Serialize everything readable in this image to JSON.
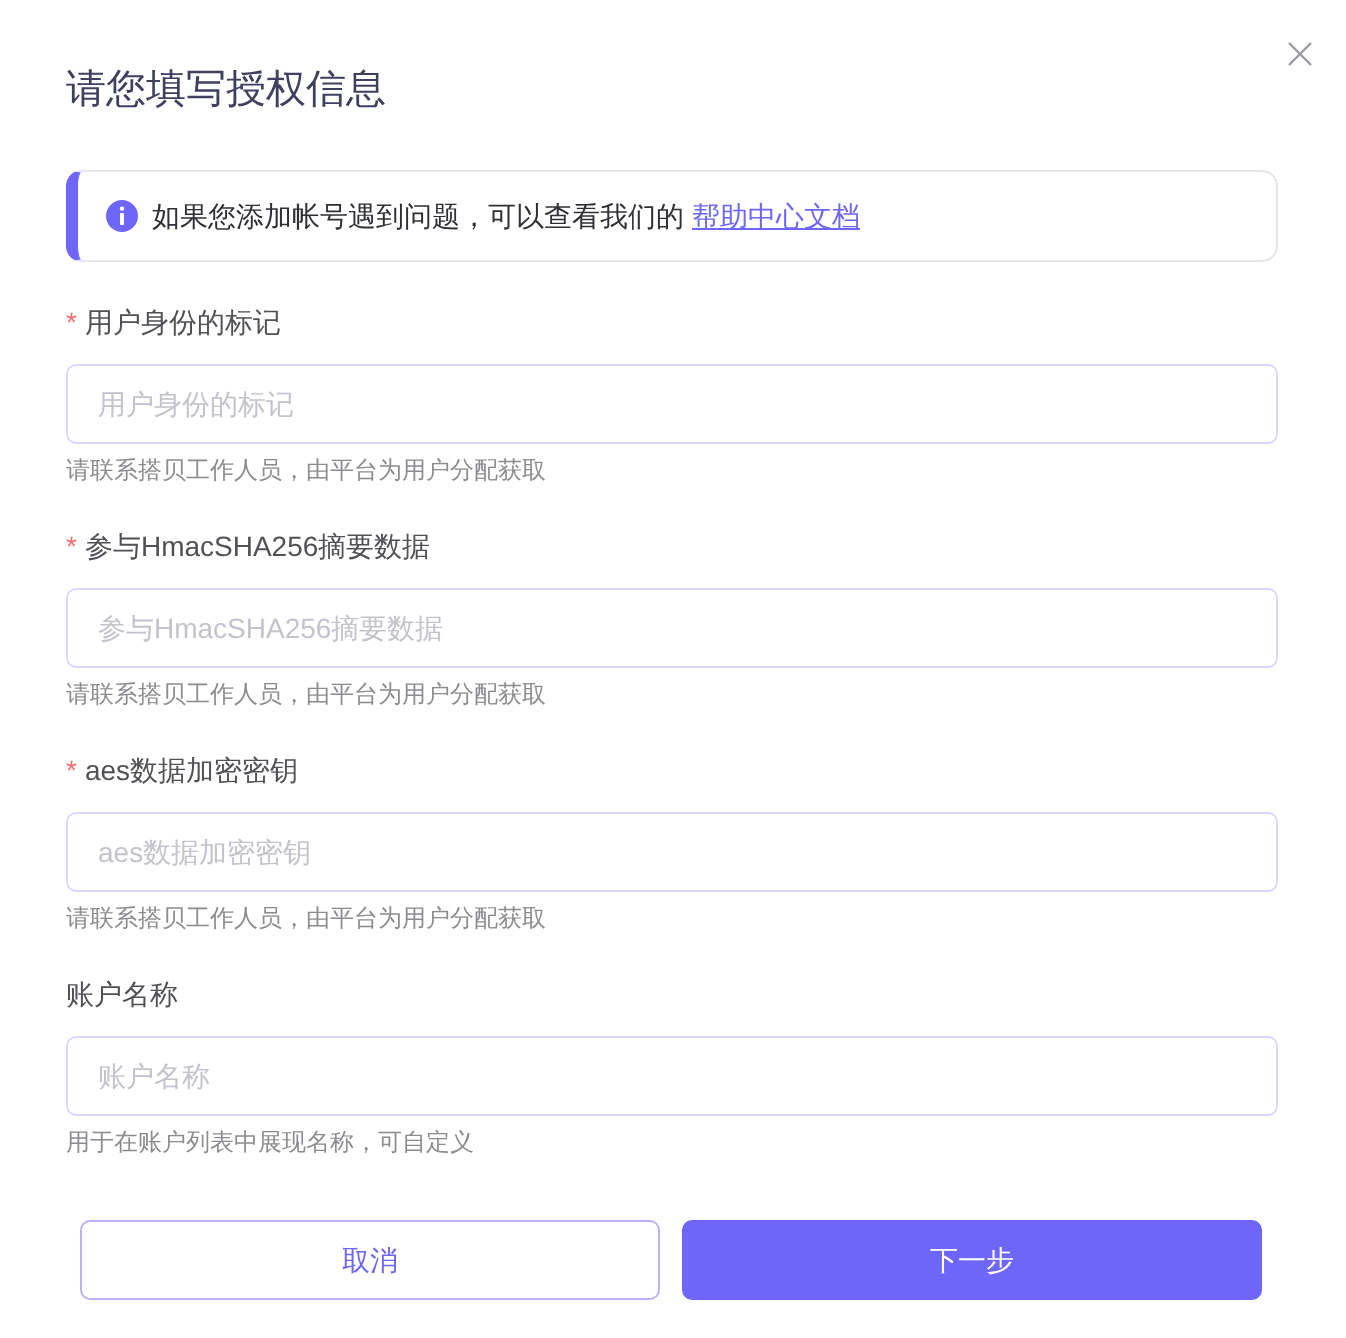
{
  "dialog": {
    "title": "请您填写授权信息"
  },
  "notice": {
    "text": "如果您添加帐号遇到问题，可以查看我们的",
    "link": "帮助中心文档"
  },
  "fields": [
    {
      "required_mark": "*",
      "label": "用户身份的标记",
      "placeholder": "用户身份的标记",
      "hint": "请联系搭贝工作人员，由平台为用户分配获取"
    },
    {
      "required_mark": "*",
      "label": "参与HmacSHA256摘要数据",
      "placeholder": "参与HmacSHA256摘要数据",
      "hint": "请联系搭贝工作人员，由平台为用户分配获取"
    },
    {
      "required_mark": "*",
      "label": "aes数据加密密钥",
      "placeholder": "aes数据加密密钥",
      "hint": "请联系搭贝工作人员，由平台为用户分配获取"
    },
    {
      "label": "账户名称",
      "placeholder": "账户名称",
      "hint": "用于在账户列表中展现名称，可自定义"
    }
  ],
  "buttons": [
    {
      "label": "取消",
      "kind": "secondary"
    },
    {
      "label": "下一步",
      "kind": "primary"
    }
  ]
}
